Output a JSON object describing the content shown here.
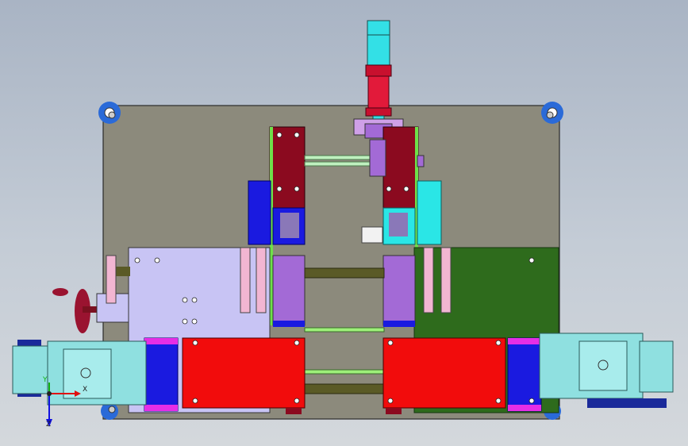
{
  "viewport": {
    "background_top": "#a9b4c4",
    "background_bottom": "#d4d8dc"
  },
  "colors": {
    "base_plate": "#8c8a7c",
    "cylinder": "#33e0e6",
    "cylinder_band": "#c8102e",
    "dark_red": "#8b0a1f",
    "blue": "#1a1ae0",
    "cyan": "#2ae6e6",
    "lavender": "#c8c4f4",
    "green_plate": "#2e6b1c",
    "red_block": "#f20c0c",
    "violet": "#a36ad6",
    "motor_cyan": "#8fe0e0",
    "olive_rod": "#5a5a26",
    "lime": "#9ef07a",
    "pink": "#f2b6d2",
    "magenta": "#e62ee6",
    "handwheel": "#9a1330"
  },
  "triad": {
    "x_label": "X",
    "y_label": "Y",
    "z_label": "Z",
    "icons": [
      "coordinate-triad-icon"
    ]
  }
}
